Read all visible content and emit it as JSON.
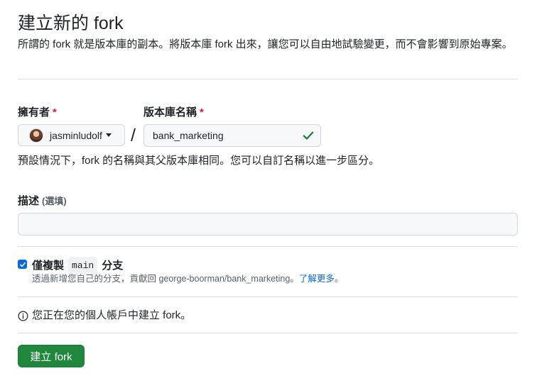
{
  "header": {
    "title": "建立新的 fork",
    "subtitle": "所謂的 fork 就是版本庫的副本。將版本庫 fork 出來，讓您可以自由地試驗變更，而不會影響到原始專案。"
  },
  "owner": {
    "label": "擁有者",
    "required_mark": "*",
    "selected": "jasminludolf"
  },
  "repo_name": {
    "label": "版本庫名稱",
    "required_mark": "*",
    "value": "bank_marketing"
  },
  "separator": "/",
  "name_hint": "預設情況下，fork 的名稱與其父版本庫相同。您可以自訂名稱以進一步區分。",
  "description": {
    "label": "描述",
    "optional": "(選填)",
    "value": ""
  },
  "copy_main": {
    "checked": true,
    "label_prefix": "僅複製",
    "branch": "main",
    "label_suffix": "分支",
    "desc": "透過新增您自己的分支，貢獻回 george-boorman/bank_marketing。",
    "link": "了解更多",
    "desc_end": "。"
  },
  "info": {
    "text": "您正在您的個人帳戶中建立 fork。"
  },
  "create_button": {
    "label": "建立 fork",
    "color": "#1f883d"
  },
  "icons": {
    "check": "check-icon",
    "info": "info-icon",
    "caret": "chevron-down-icon"
  }
}
